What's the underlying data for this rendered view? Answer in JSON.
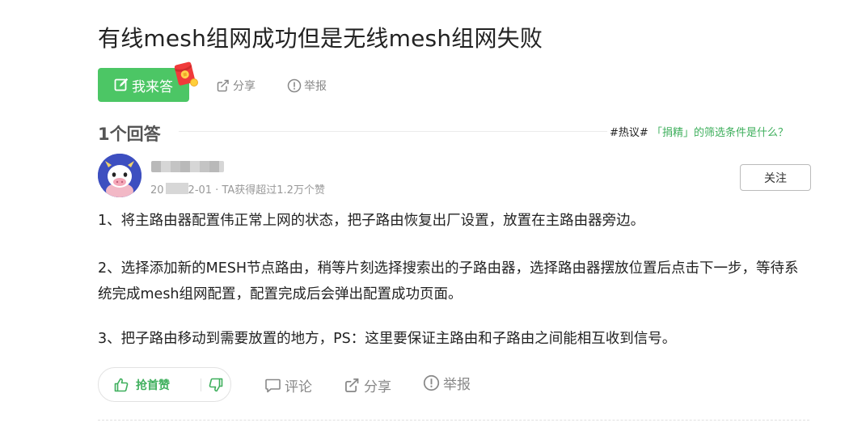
{
  "question": {
    "title": "有线mesh组网成功但是无线mesh组网失败"
  },
  "actions": {
    "answer_label": "我来答",
    "share_label": "分享",
    "report_label": "举报"
  },
  "answers_header": {
    "count_label": "1个回答",
    "hot_tag": "#热议#",
    "hot_question": "「捐精」的筛选条件是什么？"
  },
  "answer": {
    "meta_date": "20",
    "meta_rest": "2-01 · TA获得超过1.2万个赞",
    "follow_label": "关注",
    "paragraphs": [
      "1、将主路由器配置伟正常上网的状态，把子路由恢复出厂设置，放置在主路由器旁边。",
      "2、选择添加新的MESH节点路由，稍等片刻选择搜索出的子路由器，选择路由器摆放位置后点击下一步，等待系统完成mesh组网配置，配置完成后会弹出配置成功页面。",
      "3、把子路由移动到需要放置的地方，PS：这里要保证主路由和子路由之间能相互收到信号。"
    ],
    "like_label": "抢首赞",
    "comment_label": "评论",
    "share_label": "分享",
    "report_label": "举报"
  },
  "colors": {
    "brand_green": "#4cc665",
    "link_green": "#3eaf5c",
    "muted_gray": "#888888"
  }
}
